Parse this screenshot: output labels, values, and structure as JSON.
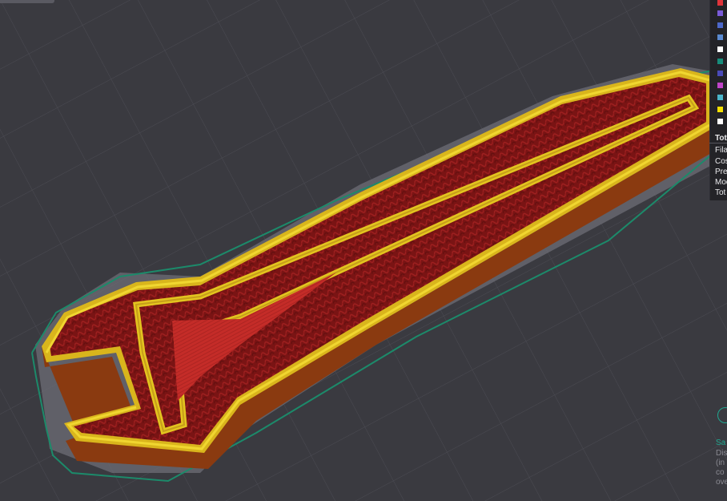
{
  "colors": {
    "background": "#3a3a40",
    "grid": "#4a4a52",
    "wall_outer": "#e3c51f",
    "wall_inner": "#c79e1a",
    "infill": "#7a1414",
    "top_solid": "#c22d28",
    "side_wall": "#8a3a10",
    "skirt": "#1c8a6a",
    "shadow": "#6e6e76"
  },
  "legend": {
    "swatches": [
      "#e0343a",
      "#7a5bd8",
      "#4d68c9",
      "#5a8ad0",
      "#ffffff",
      "#178c7a",
      "#4a4ab8",
      "#c044c8",
      "#4ab4c8",
      "#f4e000",
      "#ffffff"
    ],
    "header": "Tot",
    "rows": [
      "Fila",
      "Cos",
      "Pre",
      "Mod",
      "Tot"
    ]
  },
  "notification": {
    "icon": "info-icon",
    "title": "Sa",
    "lines": [
      "Dis",
      "(in",
      "co",
      "ove"
    ]
  }
}
